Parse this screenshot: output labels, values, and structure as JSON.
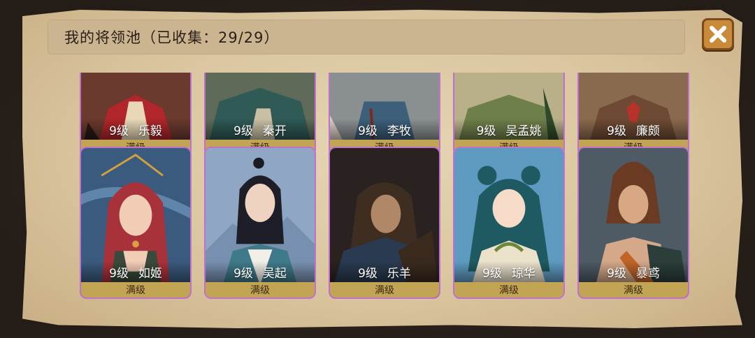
{
  "header": {
    "title": "我的将领池（已收集：29/29）"
  },
  "close_icon": "close-icon",
  "colors": {
    "frame": "#c070d0",
    "maxed_band": "#c2a455",
    "parchment": "#d8c39c"
  },
  "generals_top": [
    {
      "level": "9级",
      "name": "乐毅",
      "status": "满级"
    },
    {
      "level": "9级",
      "name": "秦开",
      "status": "满级"
    },
    {
      "level": "9级",
      "name": "李牧",
      "status": "满级"
    },
    {
      "level": "9级",
      "name": "吴孟姚",
      "status": "满级"
    },
    {
      "level": "9级",
      "name": "廉颇",
      "status": "满级"
    }
  ],
  "generals_bottom": [
    {
      "level": "9级",
      "name": "如姬",
      "status": "满级"
    },
    {
      "level": "9级",
      "name": "吴起",
      "status": "满级"
    },
    {
      "level": "9级",
      "name": "乐羊",
      "status": "满级"
    },
    {
      "level": "9级",
      "name": "琼华",
      "status": "满级"
    },
    {
      "level": "9级",
      "name": "暴鸢",
      "status": "满级"
    }
  ]
}
